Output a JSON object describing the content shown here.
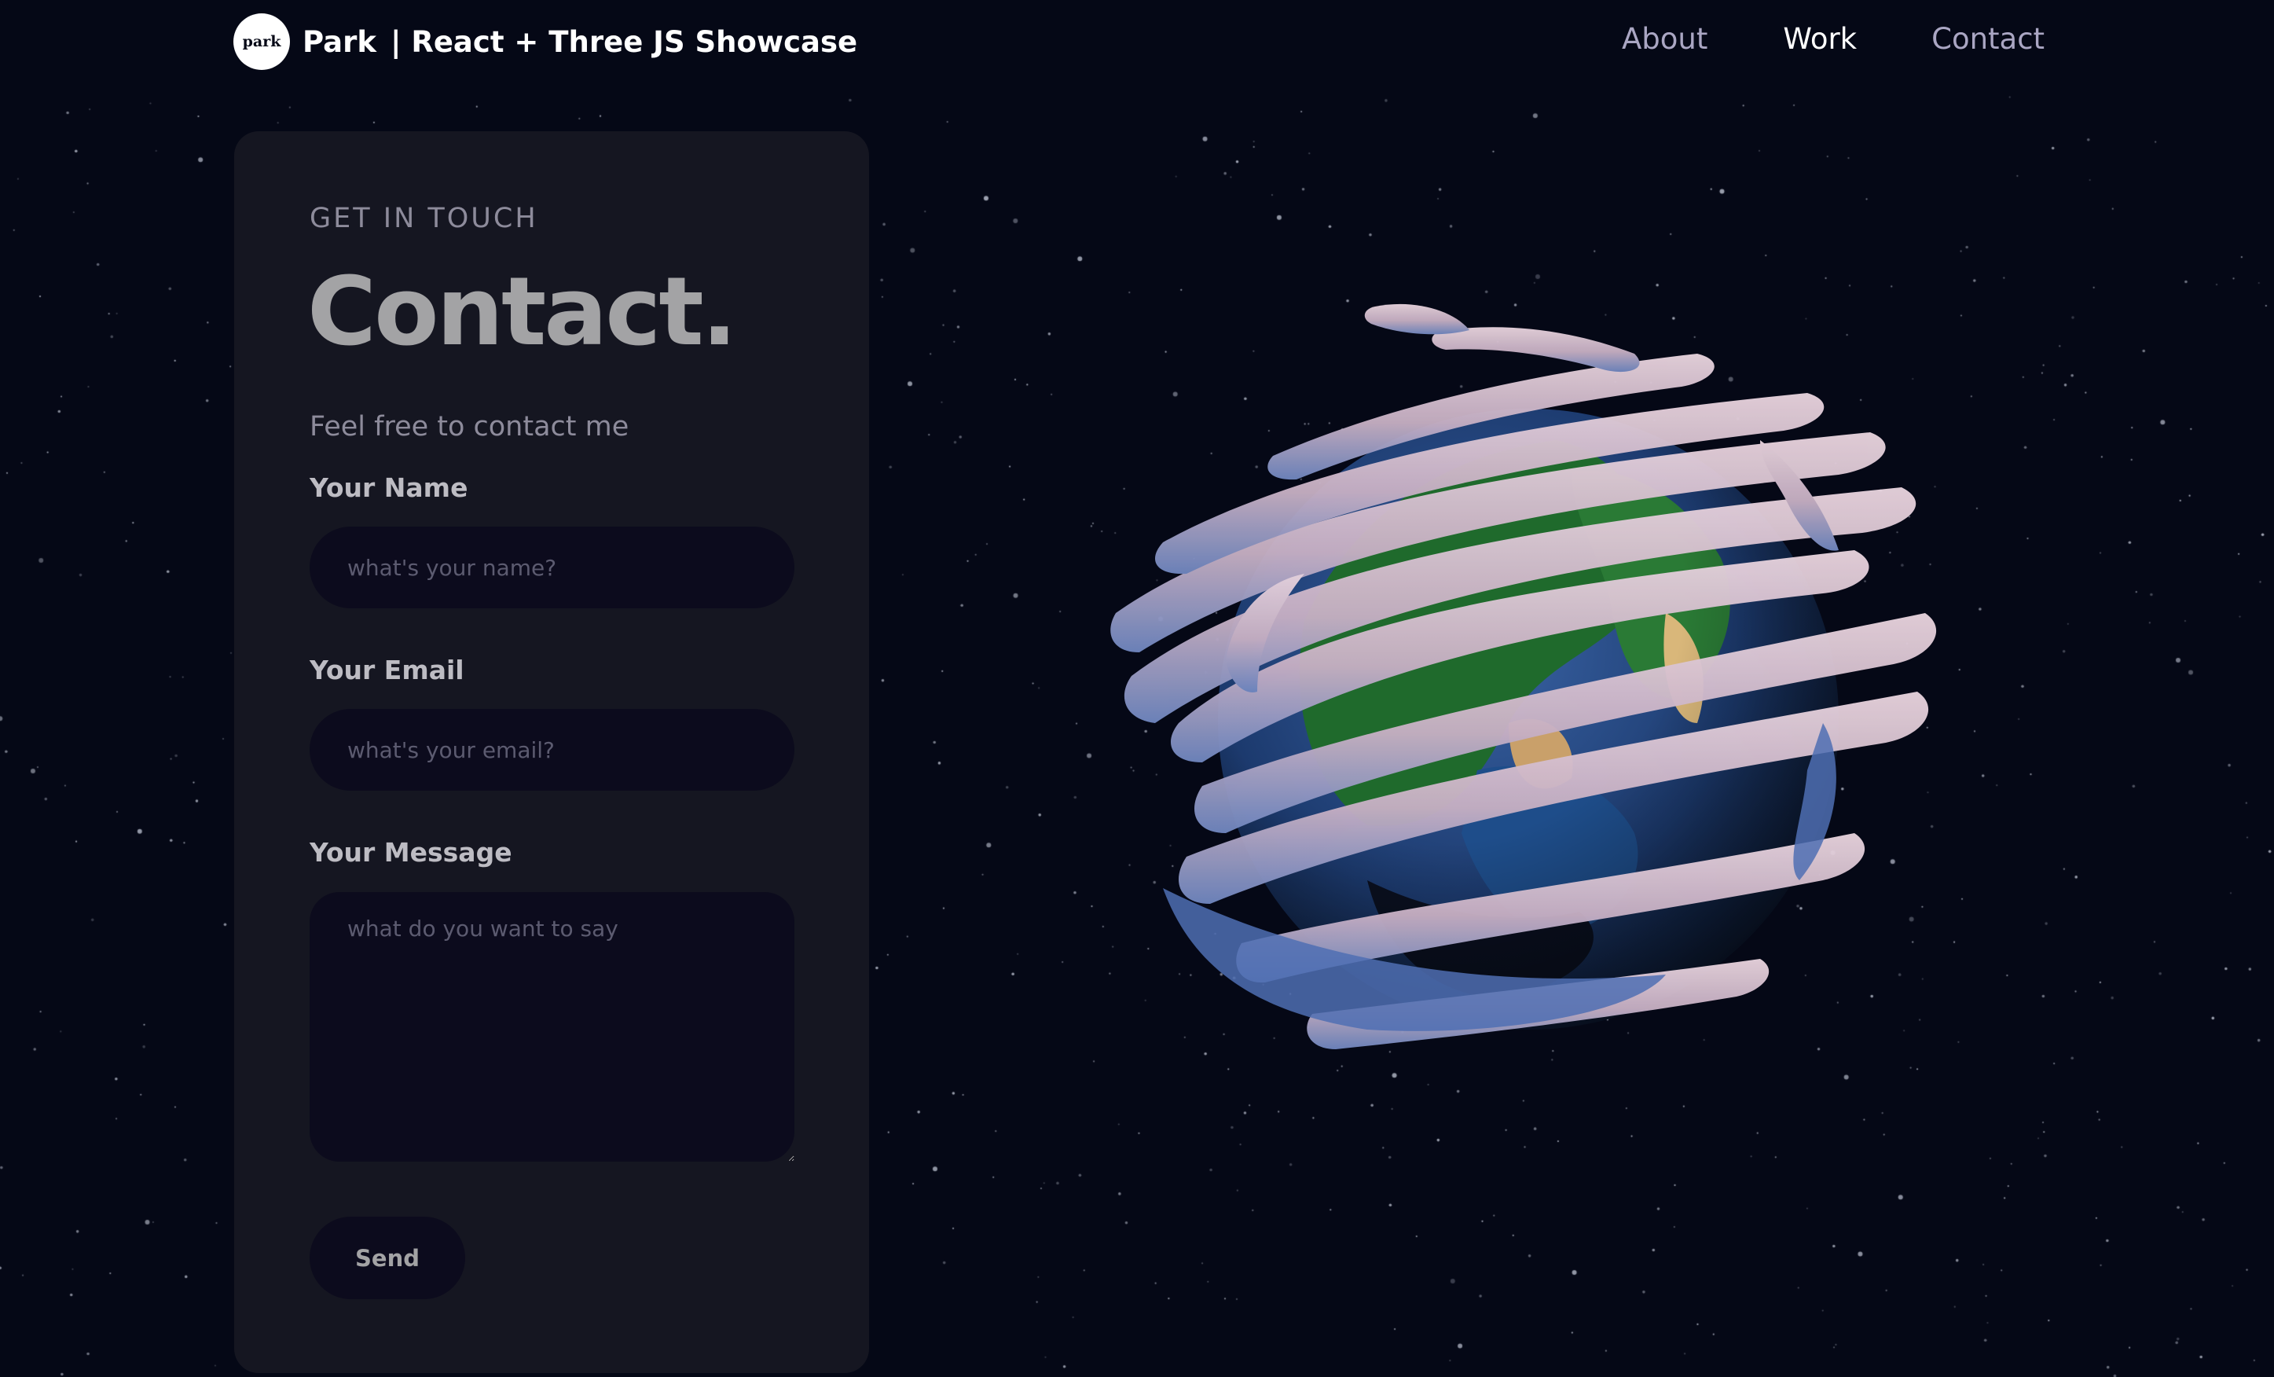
{
  "navbar": {
    "logo_text": "park",
    "brand_name": "Park",
    "brand_subtitle": "| React + Three JS Showcase",
    "links": [
      "About",
      "Work",
      "Contact"
    ],
    "active_link": "Work"
  },
  "contact": {
    "subtitle": "GET IN TOUCH",
    "title": "Contact.",
    "intro": "Feel free to contact me",
    "name_label": "Your Name",
    "name_placeholder": "what's your name?",
    "email_label": "Your Email",
    "email_placeholder": "what's your email?",
    "message_label": "Your Message",
    "message_placeholder": "what do you want to say",
    "send_label": "Send"
  },
  "colors": {
    "background": "#050816",
    "card": "#151621",
    "field": "#0c0b1d",
    "secondary_text": "#aaa6c3",
    "heading": "#a3a3a5"
  },
  "scene": {
    "model": "earth-globe-icon"
  }
}
